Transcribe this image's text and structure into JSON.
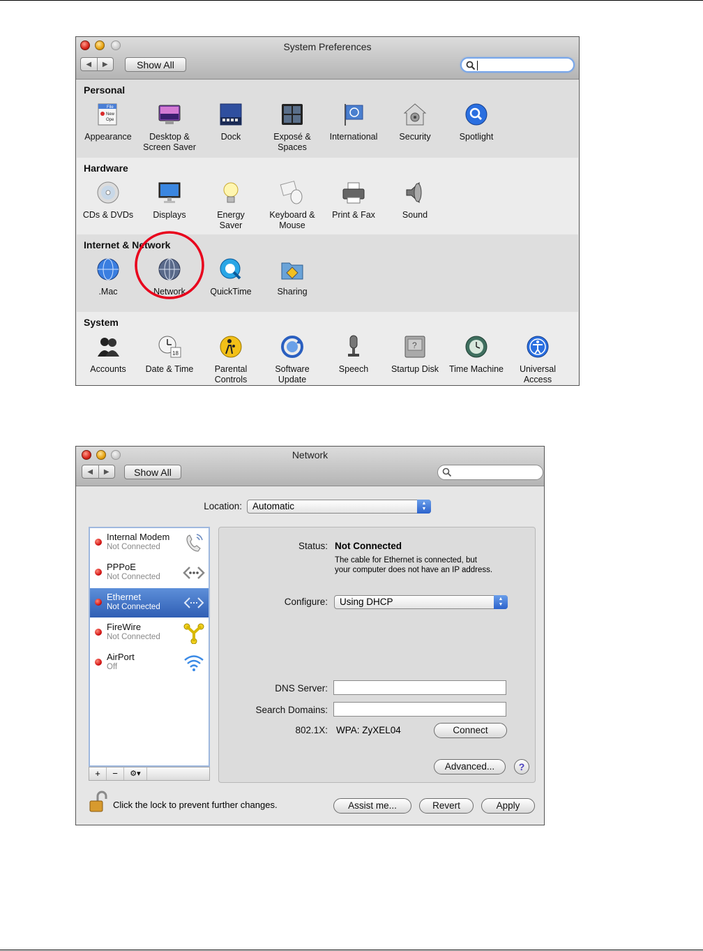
{
  "sysprefs": {
    "title": "System Preferences",
    "show_all": "Show All",
    "search_value": "",
    "sections": [
      {
        "title": "Personal",
        "items": [
          {
            "label": "Appearance",
            "icon": "appearance-icon"
          },
          {
            "label": "Desktop &\nScreen Saver",
            "icon": "desktop-screensaver-icon"
          },
          {
            "label": "Dock",
            "icon": "dock-icon"
          },
          {
            "label": "Exposé &\nSpaces",
            "icon": "expose-spaces-icon"
          },
          {
            "label": "International",
            "icon": "international-flag-icon"
          },
          {
            "label": "Security",
            "icon": "security-house-icon"
          },
          {
            "label": "Spotlight",
            "icon": "spotlight-magnifier-icon"
          }
        ]
      },
      {
        "title": "Hardware",
        "items": [
          {
            "label": "CDs & DVDs",
            "icon": "cd-dvd-icon"
          },
          {
            "label": "Displays",
            "icon": "display-monitor-icon"
          },
          {
            "label": "Energy\nSaver",
            "icon": "lightbulb-icon"
          },
          {
            "label": "Keyboard &\nMouse",
            "icon": "keyboard-mouse-icon"
          },
          {
            "label": "Print & Fax",
            "icon": "printer-icon"
          },
          {
            "label": "Sound",
            "icon": "speaker-icon"
          }
        ]
      },
      {
        "title": "Internet & Network",
        "items": [
          {
            "label": ".Mac",
            "icon": "dotmac-globe-icon"
          },
          {
            "label": "Network",
            "icon": "network-globe-icon"
          },
          {
            "label": "QuickTime",
            "icon": "quicktime-icon"
          },
          {
            "label": "Sharing",
            "icon": "sharing-folder-icon"
          }
        ]
      },
      {
        "title": "System",
        "items": [
          {
            "label": "Accounts",
            "icon": "accounts-people-icon"
          },
          {
            "label": "Date & Time",
            "icon": "clock-calendar-icon"
          },
          {
            "label": "Parental\nControls",
            "icon": "parental-controls-icon"
          },
          {
            "label": "Software\nUpdate",
            "icon": "software-update-icon"
          },
          {
            "label": "Speech",
            "icon": "microphone-icon"
          },
          {
            "label": "Startup Disk",
            "icon": "startup-disk-icon"
          },
          {
            "label": "Time Machine",
            "icon": "time-machine-icon"
          },
          {
            "label": "Universal\nAccess",
            "icon": "universal-access-icon"
          }
        ]
      }
    ],
    "highlight_color": "#e8001c"
  },
  "network": {
    "title": "Network",
    "show_all": "Show All",
    "search_value": "",
    "location_label": "Location:",
    "location_value": "Automatic",
    "services": [
      {
        "name": "Internal Modem",
        "status": "Not Connected",
        "icon": "modem-phone-icon"
      },
      {
        "name": "PPPoE",
        "status": "Not Connected",
        "icon": "pppoe-arrows-icon"
      },
      {
        "name": "Ethernet",
        "status": "Not Connected",
        "icon": "ethernet-arrows-icon"
      },
      {
        "name": "FireWire",
        "status": "Not Connected",
        "icon": "firewire-icon"
      },
      {
        "name": "AirPort",
        "status": "Off",
        "icon": "airport-wifi-icon"
      }
    ],
    "selected_service": "Ethernet",
    "list_buttons": [
      "+",
      "−",
      "⚙▾"
    ],
    "status_label": "Status:",
    "status_value": "Not Connected",
    "status_desc_1": "The cable for Ethernet is connected, but",
    "status_desc_2": "your computer does not have an IP address.",
    "configure_label": "Configure:",
    "configure_value": "Using DHCP",
    "dns_label": "DNS Server:",
    "dns_value": "",
    "search_domains_label": "Search Domains:",
    "search_domains_value": "",
    "dot1x_label": "802.1X:",
    "dot1x_value": "WPA: ZyXEL04",
    "connect_label": "Connect",
    "advanced_label": "Advanced...",
    "help_label": "?",
    "lock_text": "Click the lock to prevent further changes.",
    "assist_label": "Assist me...",
    "revert_label": "Revert",
    "apply_label": "Apply"
  }
}
